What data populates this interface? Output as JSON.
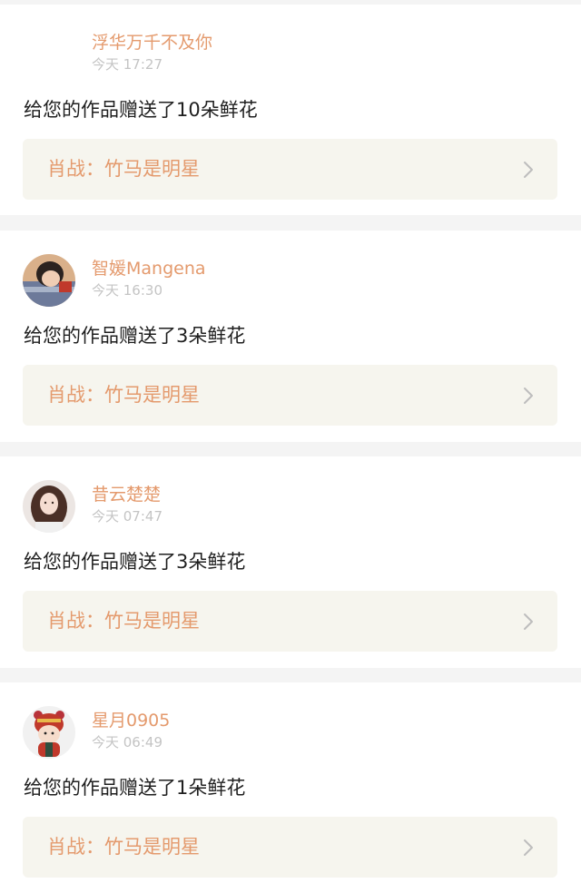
{
  "notifications": [
    {
      "username": "浮华万千不及你",
      "time": "今天 17:27",
      "message": "给您的作品赠送了10朵鲜花",
      "work_title": "肖战：竹马是明星",
      "avatar": "none"
    },
    {
      "username": "智媛Mangena",
      "time": "今天 16:30",
      "message": "给您的作品赠送了3朵鲜花",
      "work_title": "肖战：竹马是明星",
      "avatar": "photo-person-lying"
    },
    {
      "username": "昔云楚楚",
      "time": "今天 07:47",
      "message": "给您的作品赠送了3朵鲜花",
      "work_title": "肖战：竹马是明星",
      "avatar": "photo-girl-long-hair"
    },
    {
      "username": "星月0905",
      "time": "今天 06:49",
      "message": "给您的作品赠送了1朵鲜花",
      "work_title": "肖战：竹马是明星",
      "avatar": "cartoon-tiger-hat"
    }
  ],
  "colors": {
    "accent": "#e49a6d",
    "time_text": "#c4c4c4",
    "link_bg": "#f6f5ee",
    "divider_bg": "#f4f4f4"
  },
  "icons": {
    "link_arrow": "chevron-right-icon"
  }
}
